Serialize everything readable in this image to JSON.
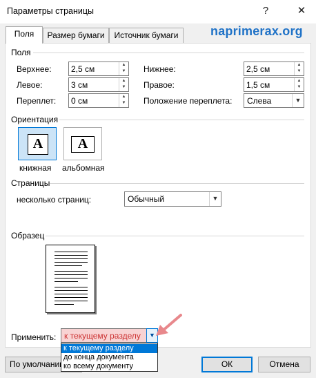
{
  "window": {
    "title": "Параметры страницы",
    "help_glyph": "?",
    "close_glyph": "✕"
  },
  "tabs": [
    {
      "label": "Поля",
      "active": true
    },
    {
      "label": "Размер бумаги",
      "active": false
    },
    {
      "label": "Источник бумаги",
      "active": false
    }
  ],
  "watermark": "naprimerax.org",
  "margins": {
    "section_title": "Поля",
    "top": {
      "label": "Верхнее:",
      "value": "2,5 см"
    },
    "bottom": {
      "label": "Нижнее:",
      "value": "2,5 см"
    },
    "left": {
      "label": "Левое:",
      "value": "3 см"
    },
    "right": {
      "label": "Правое:",
      "value": "1,5 см"
    },
    "gutter": {
      "label": "Переплет:",
      "value": "0 см"
    },
    "gutter_position": {
      "label": "Положение переплета:",
      "value": "Слева"
    }
  },
  "orientation": {
    "section_title": "Ориентация",
    "portrait": {
      "label": "книжная",
      "glyph": "A",
      "selected": true
    },
    "landscape": {
      "label": "альбомная",
      "glyph": "A",
      "selected": false
    }
  },
  "pages": {
    "section_title": "Страницы",
    "multiple_label": "несколько страниц:",
    "multiple_value": "Обычный"
  },
  "preview": {
    "section_title": "Образец"
  },
  "apply": {
    "label": "Применить:",
    "value": "к текущему разделу",
    "options": [
      "к текущему разделу",
      "до конца документа",
      "ко всему документу"
    ],
    "selected_index": 0
  },
  "buttons": {
    "default": "По умолчанию",
    "ok": "ОК",
    "cancel": "Отмена"
  },
  "colors": {
    "accent": "#0078d7",
    "watermark": "#1f72c7",
    "highlight_pink": "#f8d3d3",
    "arrow_pink": "#e8888c"
  }
}
